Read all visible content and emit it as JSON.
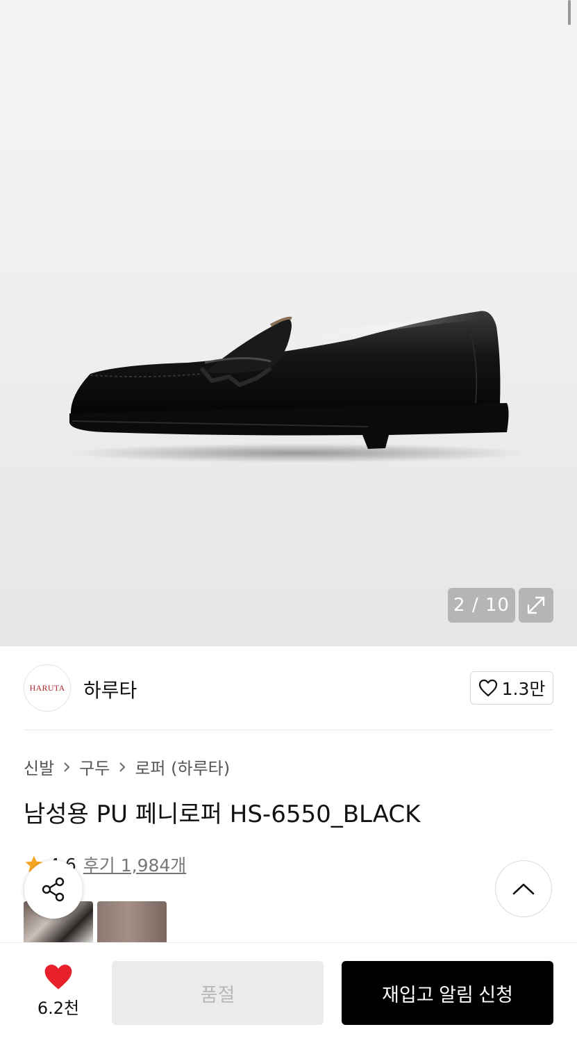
{
  "gallery": {
    "counter_text": "2 / 10",
    "image_alt": "black penny loafer side view",
    "expand_icon": "expand-icon"
  },
  "brand": {
    "logo_text": "HARUTA",
    "name": "하루타",
    "follow_count": "1.3만",
    "follow_icon": "heart-outline-icon"
  },
  "breadcrumb": {
    "items": [
      "신발",
      "구두",
      "로퍼 (하루타)"
    ]
  },
  "product": {
    "title": "남성용 PU 페니로퍼 HS-6550_BLACK",
    "rating": "4.6",
    "reviews_label": "후기 1,984개",
    "star_color": "#f5a623"
  },
  "bottom_bar": {
    "like_count": "6.2천",
    "like_color": "#e8202b",
    "soldout_label": "품절",
    "restock_label": "재입고 알림 신청"
  }
}
